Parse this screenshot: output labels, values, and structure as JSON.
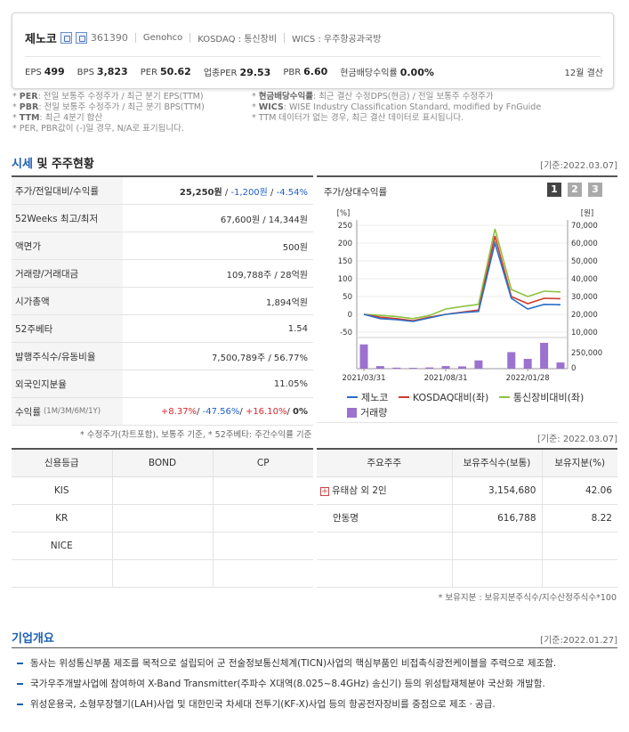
{
  "header": {
    "name": "제노코",
    "code": "361390",
    "eng": "Genohco",
    "market": "KOSDAQ : 통신장비",
    "wics": "WICS : 우주항공과국방",
    "metrics": [
      {
        "k": "EPS",
        "v": "499"
      },
      {
        "k": "BPS",
        "v": "3,823"
      },
      {
        "k": "PER",
        "v": "50.62"
      },
      {
        "k": "업종PER",
        "v": "29.53"
      },
      {
        "k": "PBR",
        "v": "6.60"
      },
      {
        "k": "현금배당수익률",
        "v": "0.00%"
      }
    ],
    "settle": "12월 결산"
  },
  "notes": {
    "left": [
      {
        "b": "PER",
        "t": ": 전일 보통주 수정주가 / 최근 분기 EPS(TTM)"
      },
      {
        "b": "PBR",
        "t": ": 전일 보통주 수정주가 / 최근 분기 BPS(TTM)"
      },
      {
        "b": "TTM",
        "t": ": 최근 4분기 합산"
      },
      {
        "b": "",
        "t": "PER, PBR값이 (-)일 경우, N/A로 표기됩니다."
      }
    ],
    "right": [
      {
        "b": "현금배당수익률",
        "t": ": 최근 결산 수정DPS(현금) / 전일 보통주 수정주가"
      },
      {
        "b": "WICS",
        "t": ": WISE Industry Classification Standard, modified by FnGuide"
      },
      {
        "b": "",
        "t": "TTM 데이터가 없는 경우, 최근 결산 데이터로 표시됩니다."
      }
    ]
  },
  "price": {
    "title_a": "시세",
    "title_b": " 및 주주현황",
    "basis": "[기준:2022.03.07]",
    "rows": [
      {
        "k": "주가/전일대비/수익률",
        "v1": "25,250원",
        "v2": "-1,200원",
        "v3": "-4.54%"
      },
      {
        "k": "52Weeks 최고/최저",
        "v": "67,600원 / 14,344원"
      },
      {
        "k": "액면가",
        "v": "500원"
      },
      {
        "k": "거래량/거래대금",
        "v": "109,788주 / 28억원"
      },
      {
        "k": "시가총액",
        "v": "1,894억원"
      },
      {
        "k": "52주베타",
        "v": "1.54"
      },
      {
        "k": "발행주식수/유동비율",
        "v": "7,500,789주 / 56.77%"
      },
      {
        "k": "외국인지분율",
        "v": "11.05%"
      },
      {
        "k": "수익률",
        "ksmall": "(1M/3M/6M/1Y)",
        "r1": "+8.37%",
        "r2": "-47.56%",
        "r3": "+16.10%",
        "r4": "0%"
      }
    ],
    "footnote": "* 수정주가(차트포함), 보통주 기준, * 52주베타: 주간수익률 기준"
  },
  "chart_panel": {
    "title": "주가/상대수익률",
    "pages": [
      "1",
      "2",
      "3"
    ]
  },
  "chart_data": {
    "type": "line",
    "x": [
      "2021/03/31",
      "2021/04/30",
      "2021/05/31",
      "2021/06/30",
      "2021/07/31",
      "2021/08/31",
      "2021/09/30",
      "2021/10/31",
      "2021/11/30",
      "2021/12/31",
      "2022/01/28",
      "2022/02/28",
      "2022/03/07"
    ],
    "x_ticks": [
      "2021/03/31",
      "2021/08/31",
      "2022/01/28"
    ],
    "left_axis": {
      "label": "[%]",
      "ticks": [
        250,
        200,
        150,
        100,
        50,
        0,
        -50
      ],
      "range": [
        -50,
        250
      ]
    },
    "right_axis": {
      "label": "[원]",
      "ticks": [
        "70,000",
        "60,000",
        "50,000",
        "40,000",
        "30,000",
        "20,000",
        "10,000"
      ],
      "range": [
        10000,
        70000
      ]
    },
    "volume_axis": {
      "ticks": [
        "250,000",
        "0"
      ],
      "range": [
        0,
        250000
      ]
    },
    "series": [
      {
        "name": "제노코",
        "color": "#2a6fc9",
        "values": [
          0,
          -12,
          -15,
          -20,
          -10,
          0,
          5,
          8,
          200,
          45,
          15,
          28,
          27
        ]
      },
      {
        "name": "KOSDAQ대비(좌)",
        "color": "#d23a2a",
        "values": [
          0,
          -8,
          -12,
          -18,
          -8,
          0,
          6,
          12,
          220,
          50,
          30,
          45,
          44
        ]
      },
      {
        "name": "통신장비대비(좌)",
        "color": "#8cc33f",
        "values": [
          0,
          -3,
          -6,
          -12,
          -3,
          15,
          22,
          28,
          240,
          70,
          50,
          65,
          63
        ]
      }
    ],
    "volume": {
      "name": "거래량",
      "color": "#9b72cf",
      "values": [
        235000,
        25000,
        10000,
        8000,
        12000,
        25000,
        22000,
        80000,
        0,
        160000,
        95000,
        265000,
        60000
      ]
    }
  },
  "credit": {
    "headers": [
      "신용등급",
      "BOND",
      "CP"
    ],
    "rows": [
      "KIS",
      "KR",
      "NICE",
      ""
    ]
  },
  "holders": {
    "basis": "[기준: 2022.03.07]",
    "headers": [
      "주요주주",
      "보유주식수(보통)",
      "보유지분(%)"
    ],
    "rows": [
      {
        "name": "유태삼 외 2인",
        "shares": "3,154,680",
        "pct": "42.06",
        "plus": "+"
      },
      {
        "name": "안동명",
        "shares": "616,788",
        "pct": "8.22",
        "plus": ""
      },
      {
        "name": "",
        "shares": "",
        "pct": "",
        "plus": ""
      },
      {
        "name": "",
        "shares": "",
        "pct": "",
        "plus": ""
      }
    ],
    "footnote": "* 보유지분 : 보유지분주식수/지수산정주식수*100"
  },
  "overview": {
    "title": "기업개요",
    "basis": "[기준:2022.01.27]",
    "items": [
      "동사는 위성통신부품 제조를 목적으로 설립되어 군 전술정보통신체계(TICN)사업의 핵심부품인 비접촉식광전케이블을 주력으로 제조함.",
      "국가우주개발사업에 참여하여 X-Band Transmitter(주파수 X대역(8.025~8.4GHz) 송신기) 등의 위성탑재체분야 국산화 개발함.",
      "위성운용국, 소형무장헬기(LAH)사업 및 대한민국 차세대 전투기(KF-X)사업 등의 항공전자장비를 중점으로 제조ㆍ공급."
    ]
  }
}
